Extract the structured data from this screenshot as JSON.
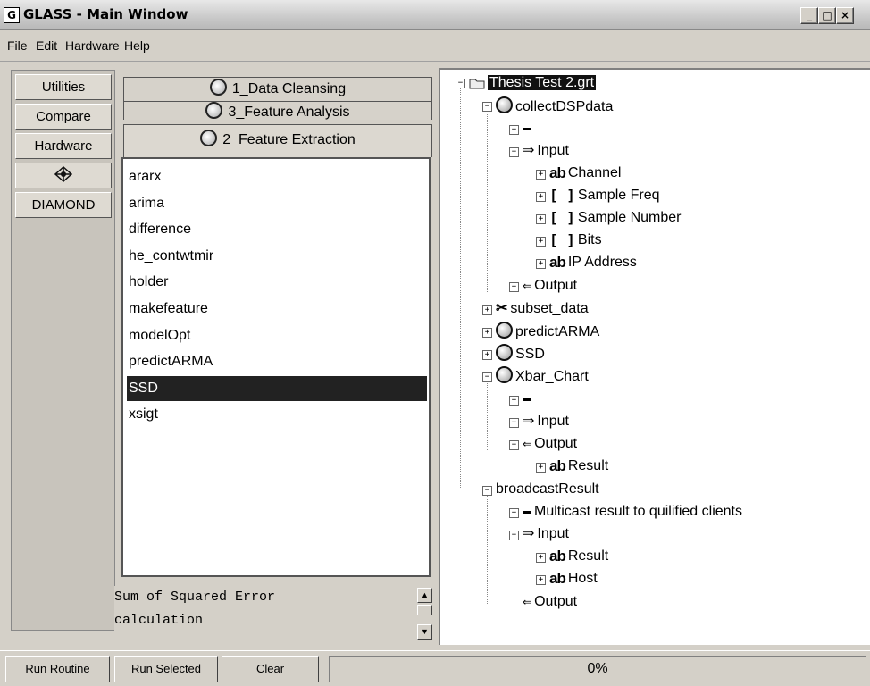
{
  "window": {
    "title": "GLASS - Main Window",
    "app_icon": "G"
  },
  "menu": {
    "items": [
      "File",
      "Edit",
      "Hardware",
      "Help"
    ]
  },
  "tools": {
    "buttons": [
      "Utilities",
      "Compare",
      "Hardware",
      "",
      "DIAMOND"
    ],
    "icon_button_icon": "network-icon"
  },
  "tabs": [
    {
      "label": "1_Data Cleansing"
    },
    {
      "label": "3_Feature Analysis"
    },
    {
      "label": "2_Feature Extraction"
    }
  ],
  "list": {
    "items": [
      "ararx",
      "arima",
      "difference",
      "he_contwtmir",
      "holder",
      "makefeature",
      "modelOpt",
      "predictARMA",
      "SSD",
      "xsigt"
    ],
    "selected": "SSD"
  },
  "description": {
    "text": "Sum of Squared Error\ncalculation"
  },
  "tree": {
    "root": "Thesis Test 2.grt",
    "nodes": {
      "collect": "collectDSPdata",
      "dash1": "",
      "input1": "Input",
      "channel": "Channel",
      "samplefreq": "Sample Freq",
      "samplenumber": "Sample Number",
      "bits": "Bits",
      "ip": "IP Address",
      "output1": "Output",
      "subset": "subset_data",
      "predict": "predictARMA",
      "ssd": "SSD",
      "xbar": "Xbar_Chart",
      "dash2": "",
      "input2": "Input",
      "output2": "Output",
      "result1": "Result",
      "broadcast": "broadcastResult",
      "multicast": "Multicast result to quilified clients",
      "input3": "Input",
      "result2": "Result",
      "host": "Host",
      "output3": "Output"
    }
  },
  "status": {
    "run_routine": "Run Routine",
    "run_selected": "Run Selected",
    "clear": "Clear",
    "progress": "0%"
  }
}
